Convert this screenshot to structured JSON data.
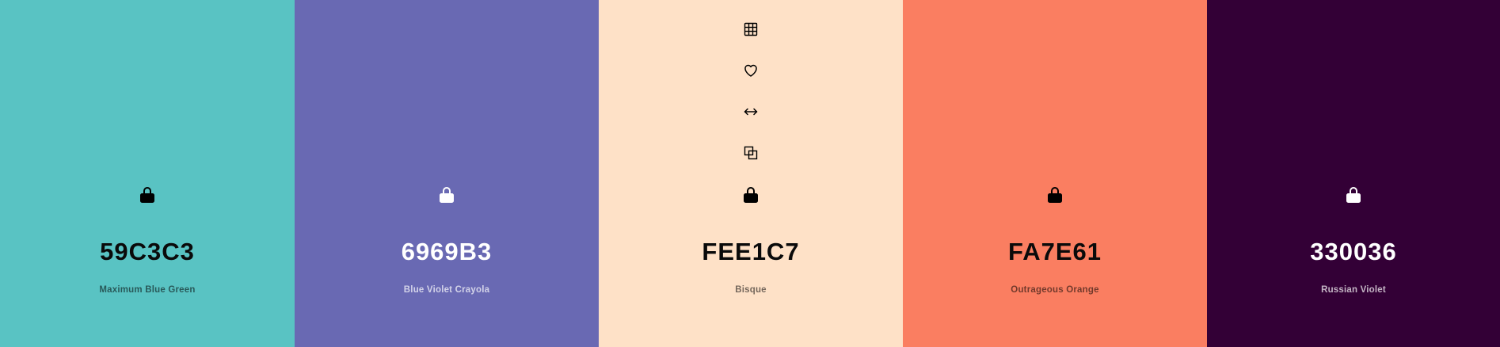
{
  "palette": {
    "colors": [
      {
        "hex": "59C3C3",
        "name": "Maximum Blue Green",
        "background": "#59C3C3",
        "text_theme": "dark",
        "lock_icon": "lock-icon"
      },
      {
        "hex": "6969B3",
        "name": "Blue Violet Crayola",
        "background": "#6969B3",
        "text_theme": "light",
        "lock_icon": "lock-icon"
      },
      {
        "hex": "FEE1C7",
        "name": "Bisque",
        "background": "#FEE1C7",
        "text_theme": "dark",
        "lock_icon": "lock-icon",
        "hover_tools": [
          "grid-icon",
          "heart-icon",
          "drag-arrows-icon",
          "copy-icon"
        ]
      },
      {
        "hex": "FA7E61",
        "name": "Outrageous Orange",
        "background": "#FA7E61",
        "text_theme": "dark",
        "lock_icon": "lock-icon"
      },
      {
        "hex": "330036",
        "name": "Russian Violet",
        "background": "#330036",
        "text_theme": "light",
        "lock_icon": "lock-icon"
      }
    ]
  }
}
